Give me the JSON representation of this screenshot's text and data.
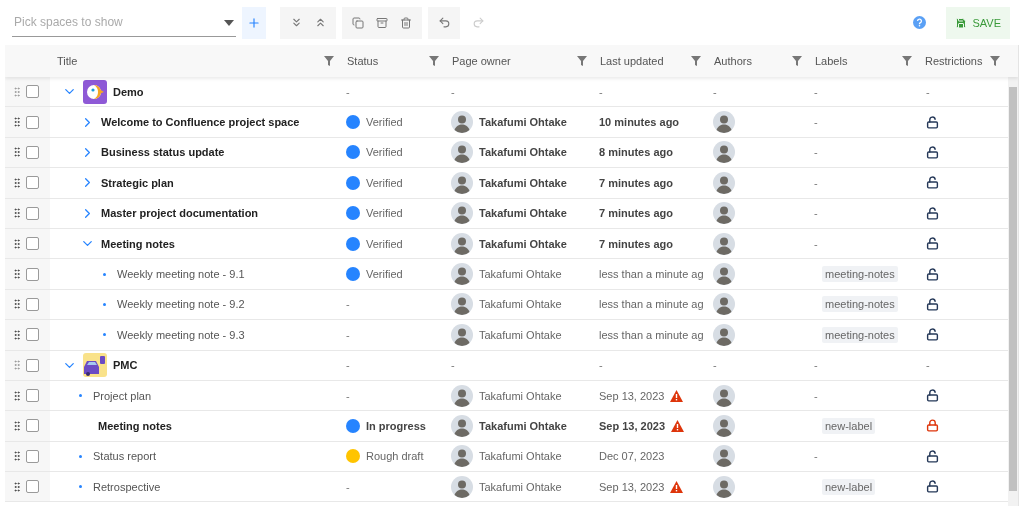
{
  "toolbar": {
    "space_picker": {
      "placeholder": "Pick spaces to show"
    },
    "redo_disabled": true,
    "save_label": "SAVE"
  },
  "table": {
    "columns": [
      "Title",
      "Status",
      "Page owner",
      "Last updated",
      "Authors",
      "Labels",
      "Restrictions"
    ],
    "rows": [
      {
        "kind": "space",
        "logo": {
          "kind": "parrot"
        },
        "title": "Demo",
        "bold": true,
        "checked": false,
        "expanded": true,
        "status": {
          "text": "-"
        },
        "owner": "-",
        "updated": {
          "text": "-",
          "warning": false
        },
        "authors": "-",
        "label": {
          "kind": "dash",
          "text": "-"
        },
        "restriction": {
          "kind": "dash",
          "text": "-"
        },
        "children": [
          {
            "kind": "page",
            "title": "Welcome to Confluence project space",
            "bold": true,
            "checked": false,
            "expanded": false,
            "status": {
              "text": "Verified",
              "color": "#2684ff"
            },
            "owner": "Takafumi Ohtake",
            "updated": {
              "text": "10 minutes ago",
              "warning": false
            },
            "label": {
              "kind": "dash",
              "text": "-"
            },
            "restriction": {
              "kind": "lock",
              "locked": false
            }
          },
          {
            "kind": "page",
            "title": "Business status update",
            "bold": true,
            "checked": false,
            "expanded": false,
            "status": {
              "text": "Verified",
              "color": "#2684ff"
            },
            "owner": "Takafumi Ohtake",
            "updated": {
              "text": "8 minutes ago",
              "warning": false
            },
            "label": {
              "kind": "dash",
              "text": "-"
            },
            "restriction": {
              "kind": "lock",
              "locked": false
            }
          },
          {
            "kind": "page",
            "title": "Strategic plan",
            "bold": true,
            "checked": false,
            "expanded": false,
            "status": {
              "text": "Verified",
              "color": "#2684ff"
            },
            "owner": "Takafumi Ohtake",
            "updated": {
              "text": "7 minutes ago",
              "warning": false
            },
            "label": {
              "kind": "dash",
              "text": "-"
            },
            "restriction": {
              "kind": "lock",
              "locked": false
            }
          },
          {
            "kind": "page",
            "title": "Master project documentation",
            "bold": true,
            "checked": false,
            "expanded": false,
            "status": {
              "text": "Verified",
              "color": "#2684ff"
            },
            "owner": "Takafumi Ohtake",
            "updated": {
              "text": "7 minutes ago",
              "warning": false
            },
            "label": {
              "kind": "dash",
              "text": "-"
            },
            "restriction": {
              "kind": "lock",
              "locked": false
            }
          },
          {
            "kind": "page",
            "title": "Meeting notes",
            "bold": true,
            "checked": false,
            "expanded": true,
            "status": {
              "text": "Verified",
              "color": "#2684ff"
            },
            "owner": "Takafumi Ohtake",
            "updated": {
              "text": "7 minutes ago",
              "warning": false
            },
            "label": {
              "kind": "dash",
              "text": "-"
            },
            "restriction": {
              "kind": "lock",
              "locked": false
            },
            "children": [
              {
                "kind": "leaf",
                "title": "Weekly meeting note - 9.1",
                "bold": false,
                "checked": false,
                "status": {
                  "text": "Verified",
                  "color": "#2684ff"
                },
                "owner": "Takafumi Ohtake",
                "updated": {
                  "text": "less than a minute ag",
                  "warning": false
                },
                "label": {
                  "kind": "tag",
                  "text": "meeting-notes"
                },
                "restriction": {
                  "kind": "lock",
                  "locked": false
                }
              },
              {
                "kind": "leaf",
                "title": "Weekly meeting note - 9.2",
                "bold": false,
                "checked": false,
                "status": {
                  "text": "-"
                },
                "owner": "Takafumi Ohtake",
                "updated": {
                  "text": "less than a minute ag",
                  "warning": false
                },
                "label": {
                  "kind": "tag",
                  "text": "meeting-notes"
                },
                "restriction": {
                  "kind": "lock",
                  "locked": false
                }
              },
              {
                "kind": "leaf",
                "title": "Weekly meeting note - 9.3",
                "bold": false,
                "checked": false,
                "status": {
                  "text": "-"
                },
                "owner": "Takafumi Ohtake",
                "updated": {
                  "text": "less than a minute ag",
                  "warning": false
                },
                "label": {
                  "kind": "tag",
                  "text": "meeting-notes"
                },
                "restriction": {
                  "kind": "lock",
                  "locked": false
                }
              }
            ]
          }
        ]
      },
      {
        "kind": "space",
        "logo": {
          "kind": "car"
        },
        "title": "PMC",
        "bold": true,
        "checked": false,
        "expanded": true,
        "status": {
          "text": "-"
        },
        "owner": "-",
        "updated": {
          "text": "-",
          "warning": false
        },
        "authors": "-",
        "label": {
          "kind": "dash",
          "text": "-"
        },
        "restriction": {
          "kind": "dash",
          "text": "-"
        },
        "children": [
          {
            "kind": "leaf",
            "title": "Project plan",
            "bold": false,
            "checked": false,
            "status": {
              "text": "-"
            },
            "owner": "Takafumi Ohtake",
            "updated": {
              "text": "Sep 13, 2023",
              "warning": true
            },
            "label": {
              "kind": "dash",
              "text": "-"
            },
            "restriction": {
              "kind": "lock",
              "locked": false
            }
          },
          {
            "kind": "plain",
            "title": "Meeting notes",
            "bold": true,
            "checked": false,
            "status": {
              "text": "In progress",
              "color": "#2684ff"
            },
            "owner": "Takafumi Ohtake",
            "updated": {
              "text": "Sep 13, 2023",
              "warning": true
            },
            "label": {
              "kind": "tag",
              "text": "new-label"
            },
            "restriction": {
              "kind": "lock",
              "locked": true
            }
          },
          {
            "kind": "leaf",
            "title": "Status report",
            "bold": false,
            "checked": false,
            "status": {
              "text": "Rough draft",
              "color": "#ffc400"
            },
            "owner": "Takafumi Ohtake",
            "updated": {
              "text": "Dec 07, 2023",
              "warning": false
            },
            "label": {
              "kind": "dash",
              "text": "-"
            },
            "restriction": {
              "kind": "lock",
              "locked": false
            }
          },
          {
            "kind": "leaf",
            "title": "Retrospective",
            "bold": false,
            "checked": false,
            "status": {
              "text": "-"
            },
            "owner": "Takafumi Ohtake",
            "updated": {
              "text": "Sep 13, 2023",
              "warning": true
            },
            "label": {
              "kind": "tag",
              "text": "new-label"
            },
            "restriction": {
              "kind": "lock",
              "locked": false
            }
          }
        ]
      }
    ]
  }
}
